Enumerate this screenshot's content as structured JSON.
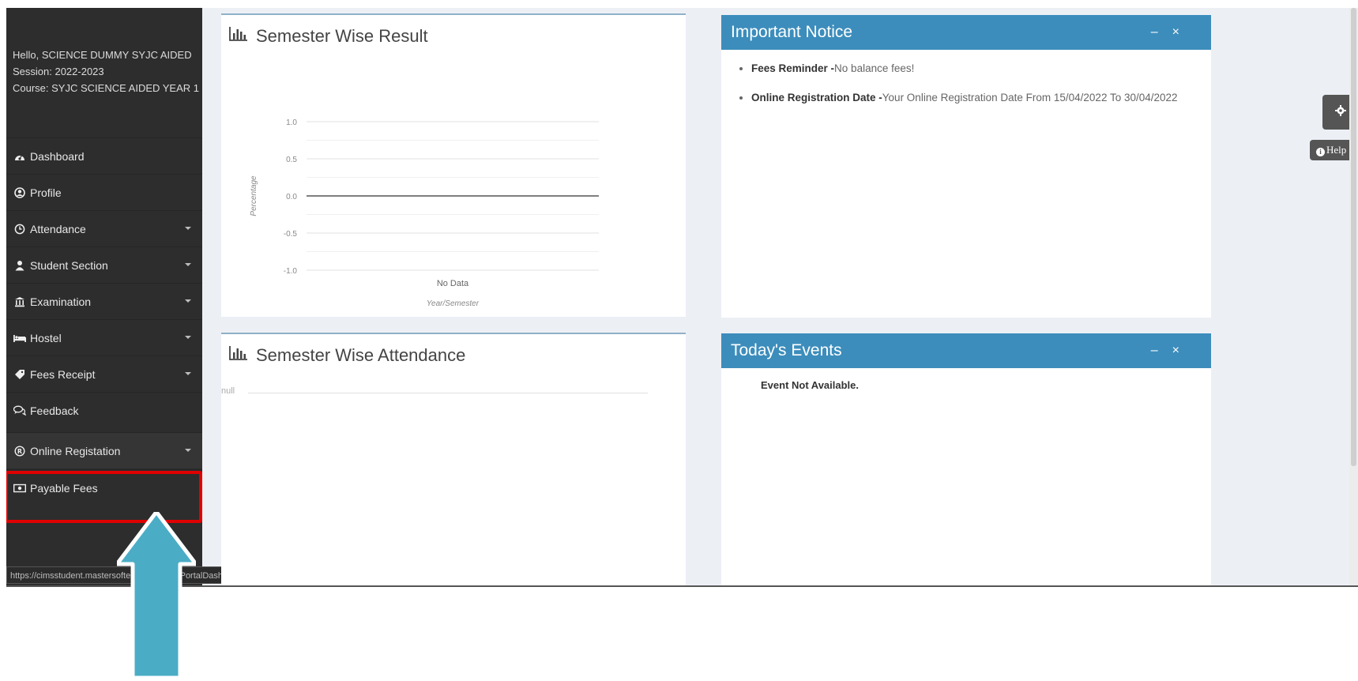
{
  "sidebar": {
    "user_greeting": "Hello, SCIENCE DUMMY SYJC AIDED",
    "session": "Session: 2022-2023",
    "course": "Course: SYJC SCIENCE AIDED YEAR 1",
    "items": [
      {
        "label": "Dashboard",
        "icon": "dashboard-icon"
      },
      {
        "label": "Profile",
        "icon": "user-circle-icon"
      },
      {
        "label": "Attendance",
        "icon": "clock-icon"
      },
      {
        "label": "Student Section",
        "icon": "user-icon"
      },
      {
        "label": "Examination",
        "icon": "bank-icon"
      },
      {
        "label": "Hostel",
        "icon": "bed-icon"
      },
      {
        "label": "Fees Receipt",
        "icon": "tag-icon"
      },
      {
        "label": "Feedback",
        "icon": "comments-icon"
      },
      {
        "label": "Online Registation",
        "icon": "registered-icon"
      },
      {
        "label": "Payable Fees",
        "icon": "money-icon"
      }
    ]
  },
  "status_url": "https://cimsstudent.mastersofterp.in/StudentPortalDashboard#",
  "result_panel": {
    "title": "Semester Wise Result",
    "chart_data": {
      "type": "line",
      "title": "Semester Wise Result",
      "xlabel": "Year/Semester",
      "ylabel": "Percentage",
      "ylim": [
        -1.0,
        1.0
      ],
      "y_ticks": [
        "1.0",
        "0.5",
        "0.0",
        "-0.5",
        "-1.0"
      ],
      "categories": [],
      "series": [],
      "no_data_text": "No Data",
      "grid": true
    }
  },
  "attendance_panel": {
    "title": "Semester Wise Attendance",
    "null_text": "null"
  },
  "notice_panel": {
    "title": "Important Notice",
    "items": [
      {
        "head": "Fees Reminder -",
        "text": "No balance fees!"
      },
      {
        "head": "Online Registration Date -",
        "text": "Your Online Registration Date From 15/04/2022 To 30/04/2022"
      }
    ]
  },
  "events_panel": {
    "title": "Today's Events",
    "message": "Event Not Available."
  },
  "help_label": "Help",
  "colors": {
    "sidebar_bg": "#2d2d2d",
    "panel_header": "#3c8dbc",
    "highlight": "#e00000",
    "arrow": "#4bacc6"
  }
}
